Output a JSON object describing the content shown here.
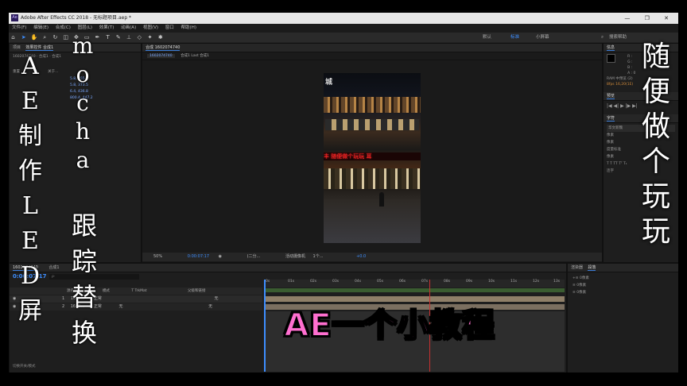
{
  "window": {
    "title": "Adobe After Effects CC 2018 - 无标题项目.aep *",
    "controls": "— ❐ ✕"
  },
  "menu": [
    "文件(F)",
    "编辑(E)",
    "合成(C)",
    "图层(L)",
    "效果(T)",
    "动画(A)",
    "视图(V)",
    "窗口",
    "帮助(H)"
  ],
  "workspaces": {
    "default": "默认",
    "standard": "标准",
    "small": "小屏幕",
    "search": "搜索帮助"
  },
  "project": {
    "tab": "项目",
    "comp_tab": "效果控件 合成1",
    "subtitle": "1602074740 · 合成1 · 合成1",
    "reset": "重置",
    "about": "关于...",
    "rows": [
      "·",
      "·",
      "·",
      "·"
    ],
    "values": [
      "5.8, 355.9",
      "5.8, 373.5",
      "6.4, 436.8",
      "800.4, 447.2"
    ]
  },
  "composition": {
    "tab": "合成 1602074740",
    "breadcrumb_1": "1602074740",
    "breadcrumb_2": "合成1 Last 合成1",
    "zoom": "50%",
    "timecode": "0:00:07:17",
    "quality": "(二分...",
    "camera": "活动摄像机",
    "views": "1个...",
    "exposure": "+0.0",
    "sign_top": "城",
    "sign_led": "丰 随便做个玩玩 耳"
  },
  "info": {
    "tab": "信息",
    "lines": [
      "R :",
      "G :",
      "B :",
      "A : 0"
    ],
    "ram": "RAM 中预览 (2)",
    "frame": "8fps  16,20(1E)"
  },
  "preview": {
    "tab": "预览",
    "controls": "|◀ ◀| ▶ |▶ ▶|"
  },
  "character": {
    "tab": "字符",
    "font": "华文新魏",
    "size": "像素",
    "leading": "像素",
    "tracking": "度量标准",
    "stroke": "像素",
    "style_buttons": "T T TT Tᵀ T₁",
    "ligatures": "连字"
  },
  "timeline": {
    "tab": "1602074740",
    "comp_tab": "合成1",
    "timecode": "0:00:07:17",
    "search_placeholder": "ρ·",
    "col_name": "源名称",
    "col_mode": "模式",
    "col_trk": "T TrkMat",
    "col_parent": "父级和链接",
    "layers": [
      {
        "num": "1",
        "name": "1602...",
        "mode": "正常",
        "trk": "",
        "parent": "无"
      },
      {
        "num": "2",
        "name": "1602...",
        "mode": "正常",
        "trk": "无",
        "parent": "无"
      }
    ],
    "ruler": [
      "0s",
      "01s",
      "02s",
      "03s",
      "04s",
      "05s",
      "06s",
      "07s",
      "08s",
      "09s",
      "10s",
      "11s",
      "12s",
      "13s"
    ],
    "toggle": "切换开关/模式"
  },
  "paragraph": {
    "tab_a": "渲染器",
    "tab_b": "段落",
    "lines": [
      "+≡ 0像素",
      "≡ 0像素",
      "≡ 0像素"
    ]
  },
  "overlay": {
    "left_col": [
      "A",
      "E",
      "制",
      "作",
      "L",
      "E",
      "D",
      "屏"
    ],
    "mid_col_a": [
      "m",
      "o",
      "c",
      "h",
      "a"
    ],
    "mid_col_b": [
      "跟",
      "踪",
      "替",
      "换"
    ],
    "right_col": [
      "随",
      "便",
      "做",
      "个",
      "玩",
      "玩"
    ],
    "banner": "AE一个小教程"
  },
  "colors": {
    "accent": "#3d8eff",
    "banner_pink": "#ff6fd0",
    "layer_bar": "#8f7f68",
    "playhead": "#c83030"
  }
}
